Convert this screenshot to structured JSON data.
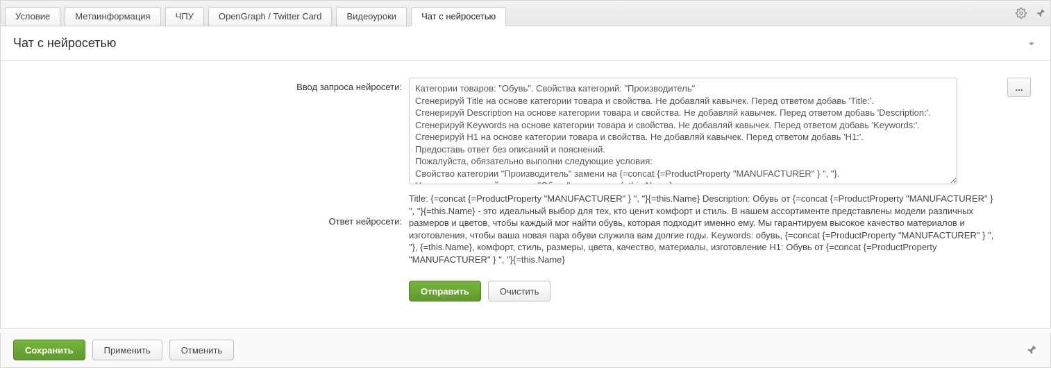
{
  "tabs": {
    "items": [
      {
        "label": "Условие"
      },
      {
        "label": "Метаинформация"
      },
      {
        "label": "ЧПУ"
      },
      {
        "label": "OpenGraph / Twitter Card"
      },
      {
        "label": "Видеоуроки"
      },
      {
        "label": "Чат с нейросетью"
      }
    ],
    "activeIndex": 5
  },
  "panel": {
    "title": "Чат с нейросетью"
  },
  "chat": {
    "prompt_label": "Ввод запроса нейросети:",
    "answer_label": "Ответ нейросети:",
    "prompt_value": "Категории товаров: \"Обувь\". Свойства категорий: \"Производитель\"\nСгенерируй Title на основе категории товара и свойства. Не добавляй кавычек. Перед ответом добавь 'Title:'.\nСгенерируй Description на основе категории товара и свойства. Не добавляй кавычек. Перед ответом добавь 'Description:'.\nСгенерируй Keywords на основе категории товара и свойства. Не добавляй кавычек. Перед ответом добавь 'Keywords:'.\nСгенерируй H1 на основе категории товара и свойства. Не добавляй кавычек. Перед ответом добавь 'H1:'.\nПредоставь ответ без описаний и пояснений.\nПожалуйста, обязательно выполни следующие условия:\nСвойство категории \"Производитель\" замени на {=concat {=ProductProperty \"MANUFACTURER\" } \", \"}.\nНазвания категорий товаров \"Обувь\", замени на {=this.Name}",
    "answer_value": "Title: {=concat {=ProductProperty \"MANUFACTURER\" } \", \"}{=this.Name} Description: Обувь от {=concat {=ProductProperty \"MANUFACTURER\" } \", \"}{=this.Name} - это идеальный выбор для тех, кто ценит комфорт и стиль. В нашем ассортименте представлены модели различных размеров и цветов, чтобы каждый мог найти обувь, которая подходит именно ему. Мы гарантируем высокое качество материалов и изготовления, чтобы ваша новая пара обуви служила вам долгие годы. Keywords: обувь, {=concat {=ProductProperty \"MANUFACTURER\" } \", \"}, {=this.Name}, комфорт, стиль, размеры, цвета, качество, материалы, изготовление H1: Обувь от {=concat {=ProductProperty \"MANUFACTURER\" } \", \"}{=this.Name}",
    "ellipsis_label": "...",
    "send_label": "Отправить",
    "clear_label": "Очистить"
  },
  "footer": {
    "save_label": "Сохранить",
    "apply_label": "Применить",
    "cancel_label": "Отменить"
  }
}
